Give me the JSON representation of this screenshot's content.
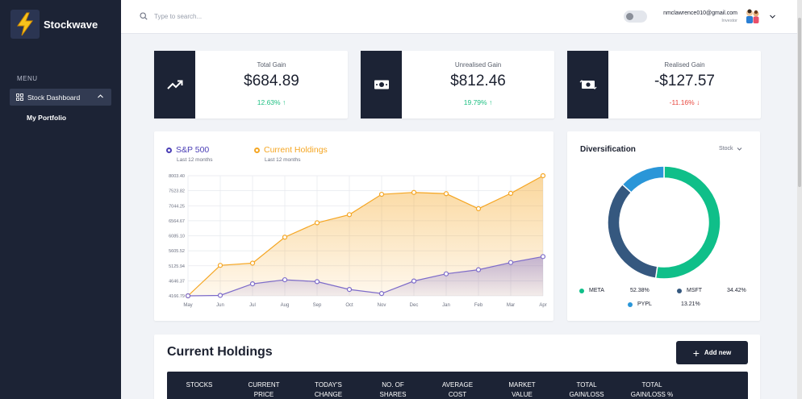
{
  "app": {
    "name": "Stockwave"
  },
  "sidebar": {
    "menu_label": "MENU",
    "items": [
      {
        "label": "Stock Dashboard",
        "icon": "grid-icon",
        "expanded": true
      }
    ],
    "sub_items": [
      {
        "label": "My Portfolio"
      }
    ]
  },
  "topbar": {
    "search_placeholder": "Type to search...",
    "user": {
      "email": "nmclawrence010@gmail.com",
      "role": "Investor"
    }
  },
  "stats": [
    {
      "label": "Total Gain",
      "value": "$684.89",
      "change": "12.63%",
      "direction": "up"
    },
    {
      "label": "Unrealised Gain",
      "value": "$812.46",
      "change": "19.79%",
      "direction": "up"
    },
    {
      "label": "Realised Gain",
      "value": "-$127.57",
      "change": "-11.16%",
      "direction": "down"
    }
  ],
  "performance": {
    "series_legend": [
      {
        "name": "S&P 500",
        "sub": "Last 12 months",
        "color": "#4b3fb6"
      },
      {
        "name": "Current Holdings",
        "sub": "Last 12 months",
        "color": "#f5a623"
      }
    ]
  },
  "chart_data": [
    {
      "type": "area",
      "categories": [
        "May",
        "Jun",
        "Jul",
        "Aug",
        "Sep",
        "Oct",
        "Nov",
        "Dec",
        "Jan",
        "Feb",
        "Mar",
        "Apr"
      ],
      "y_ticks": [
        "4166.79",
        "4646.37",
        "5125.94",
        "5605.52",
        "6085.10",
        "6564.67",
        "7044.25",
        "7523.82",
        "8003.40"
      ],
      "ylim": [
        4166.79,
        8003.4
      ],
      "grid": true,
      "series": [
        {
          "name": "S&P 500",
          "color": "#7d6bc9",
          "values": [
            4166.79,
            4180,
            4550,
            4680,
            4620,
            4370,
            4240,
            4640,
            4870,
            5000,
            5230,
            5420
          ]
        },
        {
          "name": "Current Holdings",
          "color": "#f5a623",
          "values": [
            4166.79,
            5140,
            5210,
            6040,
            6500,
            6760,
            7410,
            7470,
            7430,
            6950,
            7440,
            8003.4
          ]
        }
      ]
    },
    {
      "type": "pie",
      "title": "Diversification",
      "filter": "Stock",
      "labels": [
        "META",
        "MSFT",
        "PYPL"
      ],
      "values": [
        52.38,
        34.42,
        13.21
      ],
      "display": [
        "52.38%",
        "34.42%",
        "13.21%"
      ],
      "colors": [
        "#0fbf89",
        "#35587f",
        "#2a96d8"
      ]
    }
  ],
  "holdings": {
    "title": "Current Holdings",
    "add_label": "Add new",
    "columns": [
      [
        "STOCKS"
      ],
      [
        "CURRENT",
        "PRICE"
      ],
      [
        "TODAY'S",
        "CHANGE"
      ],
      [
        "NO. OF",
        "SHARES"
      ],
      [
        "AVERAGE",
        "COST"
      ],
      [
        "MARKET",
        "VALUE"
      ],
      [
        "TOTAL",
        "GAIN/LOSS"
      ],
      [
        "TOTAL",
        "GAIN/LOSS %"
      ]
    ]
  }
}
